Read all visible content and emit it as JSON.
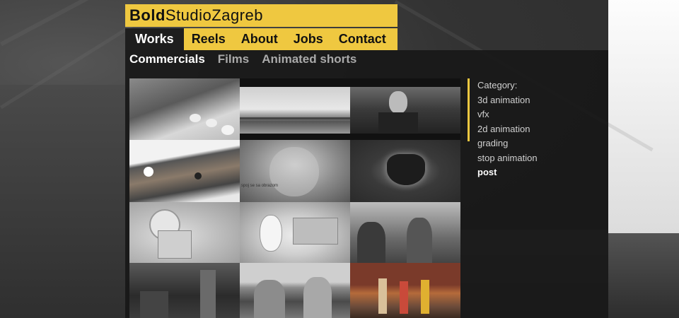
{
  "logo": {
    "part_bold": "Bold",
    "part_regular": "StudioZagreb"
  },
  "nav": {
    "tabs": [
      {
        "label": "Works",
        "active": true
      },
      {
        "label": "Reels"
      },
      {
        "label": "About"
      },
      {
        "label": "Jobs"
      },
      {
        "label": "Contact"
      }
    ]
  },
  "subnav": {
    "items": [
      {
        "label": "Commercials",
        "active": true
      },
      {
        "label": "Films"
      },
      {
        "label": "Animated shorts"
      }
    ]
  },
  "categories": {
    "heading": "Category:",
    "items": [
      {
        "label": "3d animation"
      },
      {
        "label": "vfx"
      },
      {
        "label": "2d animation"
      },
      {
        "label": "grading"
      },
      {
        "label": "stop animation"
      },
      {
        "label": "post",
        "active": true
      }
    ]
  },
  "thumbnails": {
    "count_visible": 12,
    "caption_5": "spoj se sa obrazom"
  },
  "colors": {
    "accent": "#efc840",
    "panel": "#181818",
    "active_tab_bg": "#1e1e1e"
  }
}
